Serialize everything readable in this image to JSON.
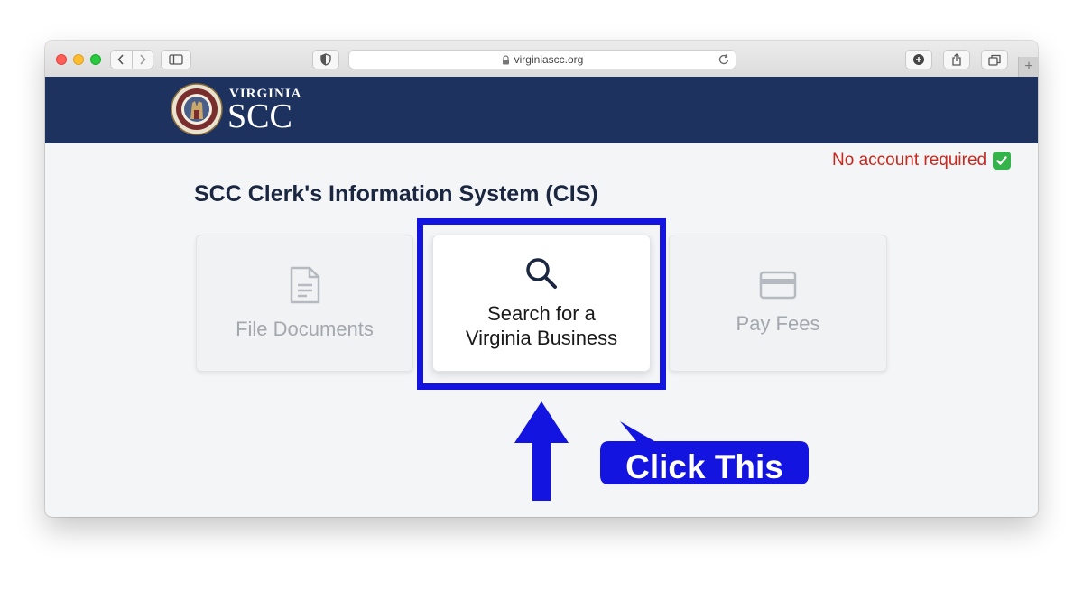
{
  "browser": {
    "url": "virginiascc.org",
    "new_tab_symbol": "+"
  },
  "header": {
    "brand_small": "VIRGINIA",
    "brand_big": "SCC"
  },
  "notice": {
    "text": "No account required"
  },
  "page": {
    "title": "SCC Clerk's Information System (CIS)"
  },
  "cards": [
    {
      "label": "File Documents",
      "icon": "document-icon",
      "state": "dimmed"
    },
    {
      "label": "Search for a Virginia Business",
      "icon": "search-icon",
      "state": "highlighted"
    },
    {
      "label": "Pay Fees",
      "icon": "credit-card-icon",
      "state": "dimmed"
    }
  ],
  "annotation": {
    "callout": "Click This",
    "color": "#1414e0"
  },
  "colors": {
    "header_bg": "#1e3260",
    "notice": "#c8281e",
    "check": "#33b34a"
  }
}
